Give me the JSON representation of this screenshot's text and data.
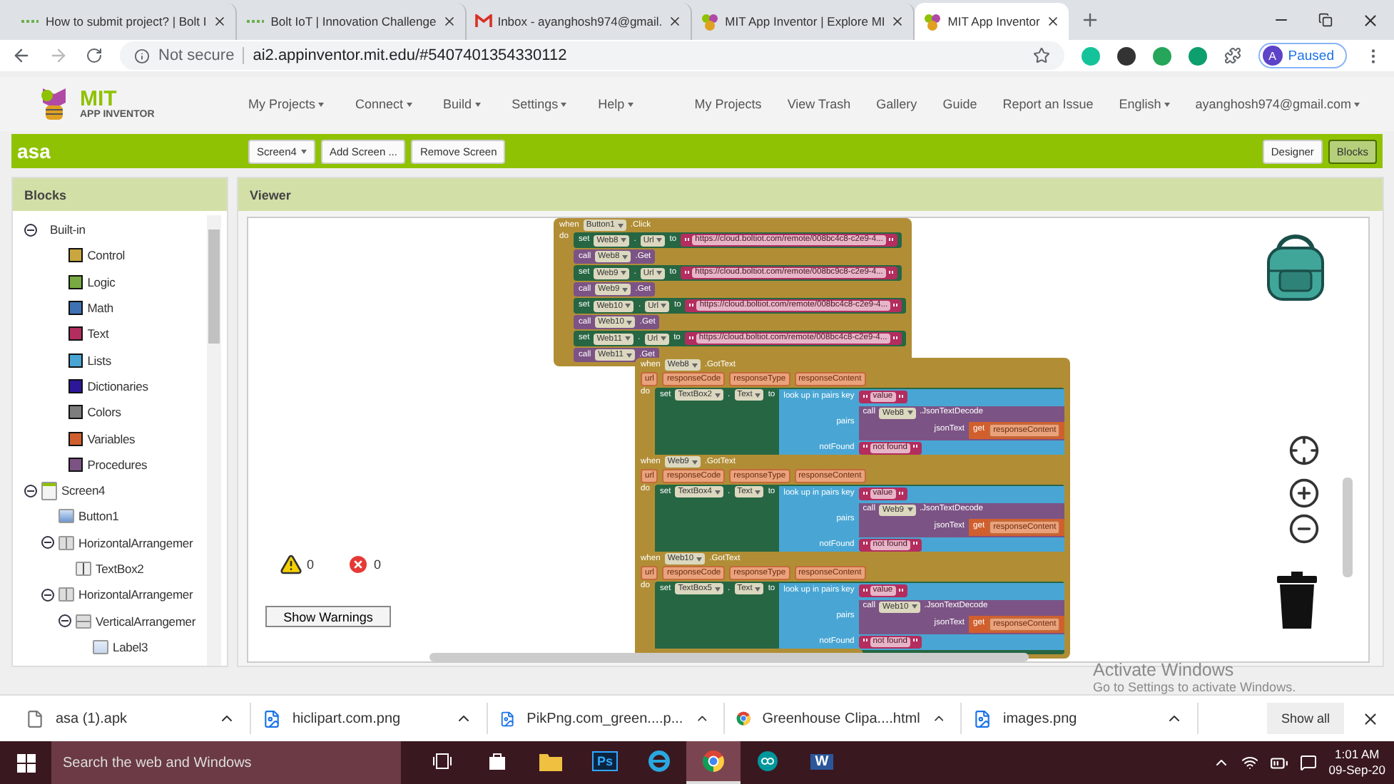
{
  "browser": {
    "tabs": [
      {
        "title": "How to submit project? | Bolt I",
        "selected": false
      },
      {
        "title": "Bolt IoT | Innovation Challenge",
        "selected": false
      },
      {
        "title": "Inbox - ayanghosh974@gmail.",
        "selected": false
      },
      {
        "title": "MIT App Inventor | Explore MI",
        "selected": false
      },
      {
        "title": "MIT App Inventor",
        "selected": true
      }
    ],
    "address": {
      "security": "Not secure",
      "url": "ai2.appinventor.mit.edu/#5407401354330112"
    },
    "profile": {
      "initial": "A",
      "status": "Paused"
    }
  },
  "app": {
    "logo": {
      "line1": "MIT",
      "line2": "APP INVENTOR"
    },
    "menu": [
      {
        "label": "My Projects",
        "dropdown": true
      },
      {
        "label": "Connect",
        "dropdown": true
      },
      {
        "label": "Build",
        "dropdown": true
      },
      {
        "label": "Settings",
        "dropdown": true
      },
      {
        "label": "Help",
        "dropdown": true
      }
    ],
    "links": [
      {
        "label": "My Projects",
        "dropdown": false
      },
      {
        "label": "View Trash",
        "dropdown": false
      },
      {
        "label": "Gallery",
        "dropdown": false
      },
      {
        "label": "Guide",
        "dropdown": false
      },
      {
        "label": "Report an Issue",
        "dropdown": false
      },
      {
        "label": "English",
        "dropdown": true
      },
      {
        "label": "ayanghosh974@gmail.com",
        "dropdown": true
      }
    ],
    "project": "asa",
    "screen_button": "Screen4",
    "toolbar": [
      "Add Screen ...",
      "Remove Screen"
    ],
    "modes": [
      {
        "label": "Designer",
        "selected": false
      },
      {
        "label": "Blocks",
        "selected": true
      }
    ]
  },
  "blocks_panel": {
    "title": "Blocks",
    "tree": [
      {
        "label": "Built-in",
        "kind": "group",
        "expanded": true,
        "children": [
          {
            "label": "Control",
            "kind": "category",
            "color": "#c9a63e"
          },
          {
            "label": "Logic",
            "kind": "category",
            "color": "#77ab41"
          },
          {
            "label": "Math",
            "kind": "category",
            "color": "#3f71b5"
          },
          {
            "label": "Text",
            "kind": "category",
            "color": "#b32d5e"
          },
          {
            "label": "Lists",
            "kind": "category",
            "color": "#49a6d4"
          },
          {
            "label": "Dictionaries",
            "kind": "category",
            "color": "#2d1799"
          },
          {
            "label": "Colors",
            "kind": "category",
            "color": "#7d7d7d"
          },
          {
            "label": "Variables",
            "kind": "category",
            "color": "#d05f2d"
          },
          {
            "label": "Procedures",
            "kind": "category",
            "color": "#7c5385"
          }
        ]
      },
      {
        "label": "Screen4",
        "kind": "screen",
        "expanded": true,
        "children": [
          {
            "label": "Button1",
            "kind": "button"
          },
          {
            "label": "HorizontalArrangemer",
            "kind": "arrangement",
            "expanded": true,
            "children": [
              {
                "label": "TextBox2",
                "kind": "textbox"
              }
            ]
          },
          {
            "label": "HorizontalArrangemer",
            "kind": "arrangement",
            "expanded": true,
            "children": [
              {
                "label": "VerticalArrangemer",
                "kind": "vertical",
                "expanded": true,
                "children": [
                  {
                    "label": "Label3",
                    "kind": "label"
                  }
                ]
              }
            ]
          }
        ]
      }
    ]
  },
  "viewer": {
    "title": "Viewer",
    "click_block": {
      "header": [
        {
          "kind": "word",
          "text": "when"
        },
        {
          "kind": "dropdown",
          "text": "Button1"
        },
        {
          "kind": "word",
          "text": ".Click"
        }
      ],
      "do": "do",
      "statements": [
        {
          "kind": "set",
          "tokens": [
            {
              "kind": "word",
              "text": "set"
            },
            {
              "kind": "dropdown",
              "text": "Web8"
            },
            {
              "kind": "word",
              "text": "."
            },
            {
              "kind": "dropdown",
              "text": "Url"
            },
            {
              "kind": "word",
              "text": "to"
            },
            {
              "kind": "string",
              "text": "https://cloud.boltiot.com/remote/008bc4c8-c2e9-4..."
            }
          ]
        },
        {
          "kind": "call",
          "tokens": [
            {
              "kind": "word",
              "text": "call"
            },
            {
              "kind": "dropdown",
              "text": "Web8"
            },
            {
              "kind": "word",
              "text": ".Get"
            }
          ]
        },
        {
          "kind": "set",
          "tokens": [
            {
              "kind": "word",
              "text": "set"
            },
            {
              "kind": "dropdown",
              "text": "Web9"
            },
            {
              "kind": "word",
              "text": "."
            },
            {
              "kind": "dropdown",
              "text": "Url"
            },
            {
              "kind": "word",
              "text": "to"
            },
            {
              "kind": "string",
              "text": "https://cloud.boltiot.com/remote/008bc9c8-c2e9-4..."
            }
          ]
        },
        {
          "kind": "call",
          "tokens": [
            {
              "kind": "word",
              "text": "call"
            },
            {
              "kind": "dropdown",
              "text": "Web9"
            },
            {
              "kind": "word",
              "text": ".Get"
            }
          ]
        },
        {
          "kind": "set",
          "tokens": [
            {
              "kind": "word",
              "text": "set"
            },
            {
              "kind": "dropdown",
              "text": "Web10"
            },
            {
              "kind": "word",
              "text": "."
            },
            {
              "kind": "dropdown",
              "text": "Url"
            },
            {
              "kind": "word",
              "text": "to"
            },
            {
              "kind": "string",
              "text": "https://cloud.boltiot.com/remote/008bc4c8-c2e9-4..."
            }
          ]
        },
        {
          "kind": "call",
          "tokens": [
            {
              "kind": "word",
              "text": "call"
            },
            {
              "kind": "dropdown",
              "text": "Web10"
            },
            {
              "kind": "word",
              "text": ".Get"
            }
          ]
        },
        {
          "kind": "set",
          "tokens": [
            {
              "kind": "word",
              "text": "set"
            },
            {
              "kind": "dropdown",
              "text": "Web11"
            },
            {
              "kind": "word",
              "text": "."
            },
            {
              "kind": "dropdown",
              "text": "Url"
            },
            {
              "kind": "word",
              "text": "to"
            },
            {
              "kind": "string",
              "text": "https://cloud.boltiot.com/remote/008bc4c8-c2e9-4..."
            }
          ]
        },
        {
          "kind": "call",
          "tokens": [
            {
              "kind": "word",
              "text": "call"
            },
            {
              "kind": "dropdown",
              "text": "Web11"
            },
            {
              "kind": "word",
              "text": ".Get"
            }
          ]
        }
      ]
    },
    "gottext_blocks": [
      {
        "when": "when",
        "component": "Web8",
        "event": ".GotText",
        "params": [
          "url",
          "responseCode",
          "responseType",
          "responseContent"
        ],
        "do": "do",
        "set": "set",
        "target": "TextBox2",
        "dot": ".",
        "property": "Text",
        "to": "to",
        "lookup": "look up in pairs  key",
        "key": "value",
        "pairs": "pairs",
        "call": "call",
        "decode_component": "Web8",
        "decode": ".JsonTextDecode",
        "json_text": "jsonText",
        "get": "get",
        "get_var": "responseContent",
        "not_found_label": "notFound",
        "not_found": "not found"
      },
      {
        "when": "when",
        "component": "Web9",
        "event": ".GotText",
        "params": [
          "url",
          "responseCode",
          "responseType",
          "responseContent"
        ],
        "do": "do",
        "set": "set",
        "target": "TextBox4",
        "dot": ".",
        "property": "Text",
        "to": "to",
        "lookup": "look up in pairs  key",
        "key": "value",
        "pairs": "pairs",
        "call": "call",
        "decode_component": "Web9",
        "decode": ".JsonTextDecode",
        "json_text": "jsonText",
        "get": "get",
        "get_var": "responseContent",
        "not_found_label": "notFound",
        "not_found": "not found"
      },
      {
        "when": "when",
        "component": "Web10",
        "event": ".GotText",
        "params": [
          "url",
          "responseCode",
          "responseType",
          "responseContent"
        ],
        "do": "do",
        "set": "set",
        "target": "TextBox5",
        "dot": ".",
        "property": "Text",
        "to": "to",
        "lookup": "look up in pairs  key",
        "key": "value",
        "pairs": "pairs",
        "call": "call",
        "decode_component": "Web10",
        "decode": ".JsonTextDecode",
        "json_text": "jsonText",
        "get": "get",
        "get_var": "responseContent",
        "not_found_label": "notFound",
        "not_found": "not found"
      }
    ],
    "warnings": {
      "warning_count": "0",
      "error_count": "0",
      "button": "Show Warnings"
    }
  },
  "downloads": {
    "files": [
      {
        "name": "asa (1).apk",
        "kind": "file"
      },
      {
        "name": "hiclipart.com.png",
        "kind": "image"
      },
      {
        "name": "PikPng.com_green....p...",
        "kind": "image"
      },
      {
        "name": "Greenhouse Clipa....html",
        "kind": "web"
      },
      {
        "name": "images.png",
        "kind": "image"
      }
    ],
    "show_all": "Show all"
  },
  "os_notice": {
    "title": "Activate Windows",
    "subtitle": "Go to Settings to activate Windows."
  },
  "taskbar": {
    "search_placeholder": "Search the web and Windows",
    "apps": [
      {
        "kind": "taskview",
        "selected": false
      },
      {
        "kind": "store",
        "selected": false
      },
      {
        "kind": "explorer",
        "selected": false
      },
      {
        "kind": "photoshop",
        "label": "Ps",
        "selected": false
      },
      {
        "kind": "ie",
        "selected": false
      },
      {
        "kind": "chrome",
        "selected": true
      },
      {
        "kind": "arduino",
        "selected": false
      },
      {
        "kind": "word",
        "label": "W",
        "selected": false
      }
    ],
    "time": "1:01 AM",
    "date": "09-Sep-20"
  }
}
